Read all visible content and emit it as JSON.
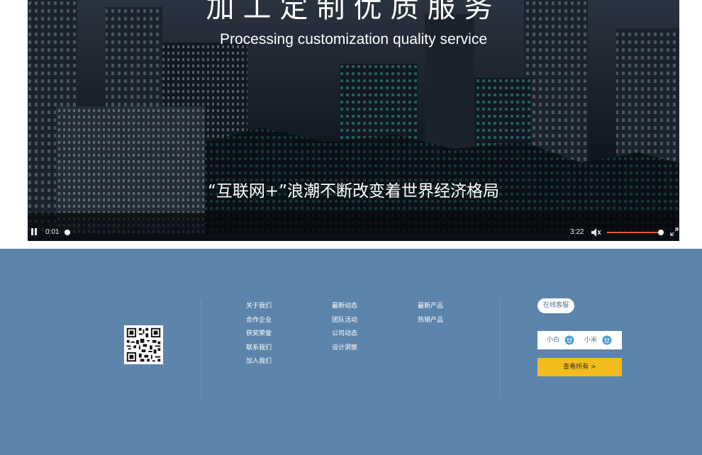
{
  "video": {
    "title_cn": "加工定制优质服务",
    "title_en": "Processing customization quality service",
    "subtitle": "“互联网+”浪潮不断改变着世界经济格局",
    "controls": {
      "current_time": "0:01",
      "duration": "3:22",
      "progress": 0.005,
      "volume": 0.9
    }
  },
  "footer": {
    "columns": [
      {
        "links": [
          "关于我们",
          "合作企业",
          "获奖荣誉",
          "联系我们",
          "加入我们"
        ]
      },
      {
        "links": [
          "最新动态",
          "团队活动",
          "公司动态",
          "设计洞察"
        ]
      },
      {
        "links": [
          "最新产品",
          "热销产品"
        ]
      }
    ],
    "service": {
      "badge": "在线客服",
      "agents": [
        {
          "name": "小白",
          "icon": "chat-bubble-icon"
        },
        {
          "name": "小米",
          "icon": "chat-bubble-icon"
        }
      ],
      "view_all": "查看所有 >"
    }
  },
  "colors": {
    "footer_bg": "#5d84ab",
    "accent_yellow": "#f2bd1c",
    "volume_bar": "#e05a2b"
  }
}
